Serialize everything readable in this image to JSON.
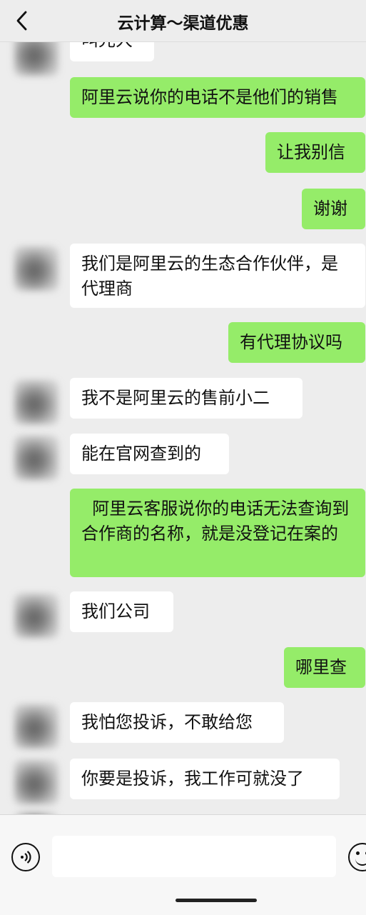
{
  "header": {
    "title": "云计算～渠道优惠"
  },
  "messages": [
    {
      "side": "left",
      "text": "叫光大"
    },
    {
      "side": "right",
      "text": "阿里云说你的电话不是他们的销售"
    },
    {
      "side": "right",
      "text": "让我别信"
    },
    {
      "side": "right",
      "text": "谢谢"
    },
    {
      "side": "left",
      "text": "我们是阿里云的生态合作伙伴，是代理商"
    },
    {
      "side": "right",
      "text": "有代理协议吗"
    },
    {
      "side": "left",
      "text": "我不是阿里云的售前小二"
    },
    {
      "side": "left",
      "text": "能在官网查到的"
    },
    {
      "side": "right",
      "text": "  阿里云客服说你的电话无法查询到合作商的名称，就是没登记在案的"
    },
    {
      "side": "left",
      "text": "我们公司"
    },
    {
      "side": "right",
      "text": "哪里查"
    },
    {
      "side": "left",
      "text": "我怕您投诉，不敢给您"
    },
    {
      "side": "left",
      "text": "你要是投诉，我工作可就没了"
    },
    {
      "side": "left",
      "text": "[image]"
    }
  ],
  "input": {
    "value": ""
  },
  "icons": {
    "back": "chevron-left-icon",
    "voice": "voice-icon",
    "emoji": "emoji-icon"
  },
  "colors": {
    "sent_bubble": "#95ec69",
    "received_bubble": "#ffffff",
    "background": "#ededed"
  }
}
